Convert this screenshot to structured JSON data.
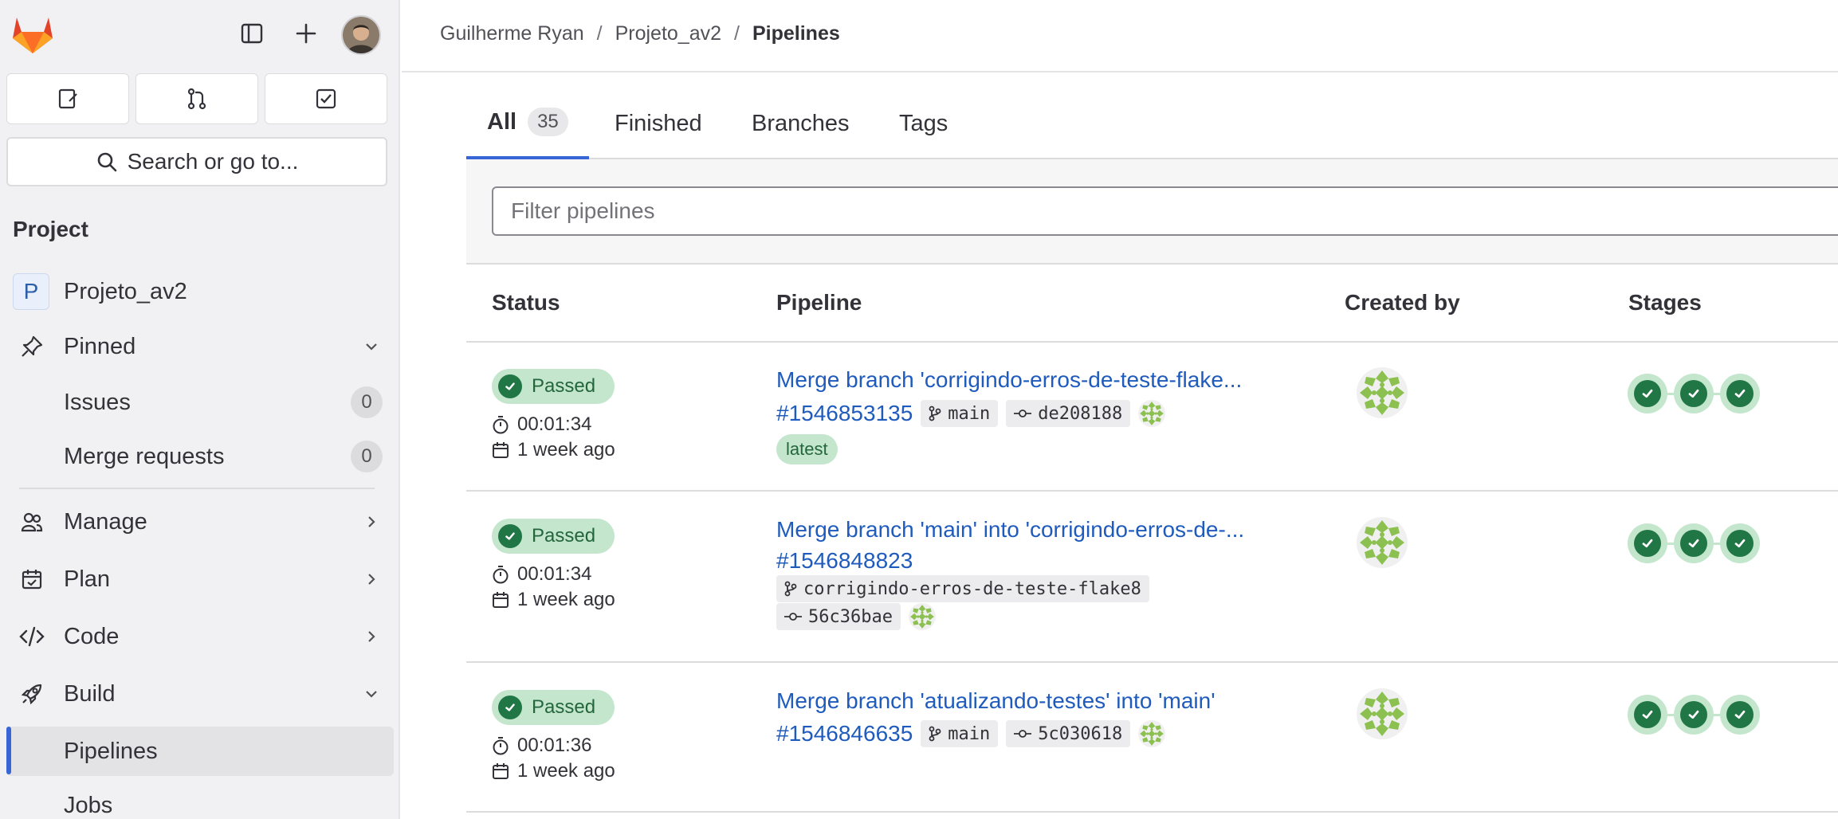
{
  "breadcrumb": {
    "user": "Guilherme Ryan",
    "project": "Projeto_av2",
    "current": "Pipelines"
  },
  "sidebar": {
    "search_label": "Search or go to...",
    "section_title": "Project",
    "project_badge": "P",
    "project_name": "Projeto_av2",
    "pinned": "Pinned",
    "issues": "Issues",
    "issues_count": "0",
    "merge_requests": "Merge requests",
    "merge_requests_count": "0",
    "manage": "Manage",
    "plan": "Plan",
    "code": "Code",
    "build": "Build",
    "pipelines": "Pipelines",
    "jobs": "Jobs"
  },
  "tabs": {
    "all": "All",
    "all_count": "35",
    "finished": "Finished",
    "branches": "Branches",
    "tags": "Tags"
  },
  "filter": {
    "placeholder": "Filter pipelines"
  },
  "table": {
    "headers": {
      "status": "Status",
      "pipeline": "Pipeline",
      "created_by": "Created by",
      "stages": "Stages"
    },
    "rows": [
      {
        "status": "Passed",
        "duration": "00:01:34",
        "finished": "1 week ago",
        "title": "Merge branch 'corrigindo-erros-de-teste-flake...",
        "id": "#1546853135",
        "branch": "main",
        "commit": "de208188",
        "tag": "latest"
      },
      {
        "status": "Passed",
        "duration": "00:01:34",
        "finished": "1 week ago",
        "title": "Merge branch 'main' into 'corrigindo-erros-de-...",
        "id": "#1546848823",
        "branch": "corrigindo-erros-de-teste-flake8",
        "commit": "56c36bae"
      },
      {
        "status": "Passed",
        "duration": "00:01:36",
        "finished": "1 week ago",
        "title": "Merge branch 'atualizando-testes' into 'main'",
        "id": "#1546846635",
        "branch": "main",
        "commit": "5c030618"
      }
    ]
  },
  "colors": {
    "accent": "#3966d6",
    "success": "#217645",
    "link": "#1f5bbd"
  }
}
